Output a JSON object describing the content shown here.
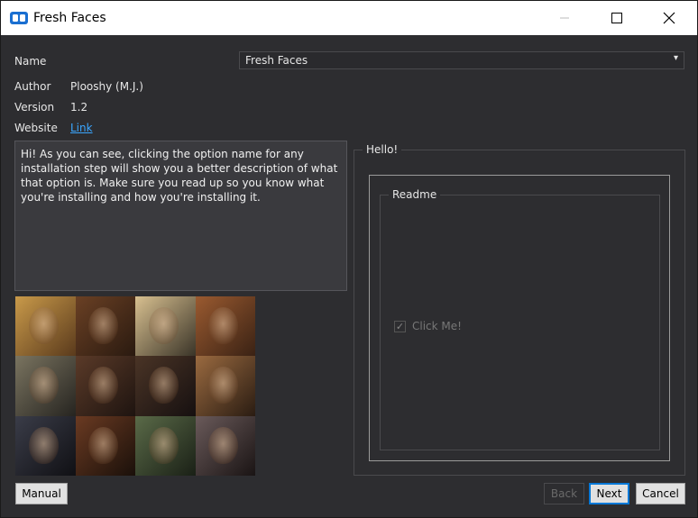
{
  "window": {
    "title": "Fresh Faces"
  },
  "header": {
    "name_label": "Name",
    "name_value": "Fresh Faces",
    "author_label": "Author",
    "author_value": "Plooshy (M.J.)",
    "version_label": "Version",
    "version_value": "1.2",
    "website_label": "Website",
    "website_link": "Link"
  },
  "description": "Hi! As you can see, clicking the option name for any installation step will show you a better description of what that option is. Make sure you read up so you know what you're installing and how you're installing it.",
  "step": {
    "title": "Hello!",
    "group_title": "Readme",
    "option_label": "Click Me!",
    "option_checked": true
  },
  "footer": {
    "manual_label": "Manual",
    "back_label": "Back",
    "next_label": "Next",
    "cancel_label": "Cancel"
  },
  "colors": {
    "link": "#3aa6ff",
    "accent": "#0078d7",
    "background": "#2d2d30"
  }
}
